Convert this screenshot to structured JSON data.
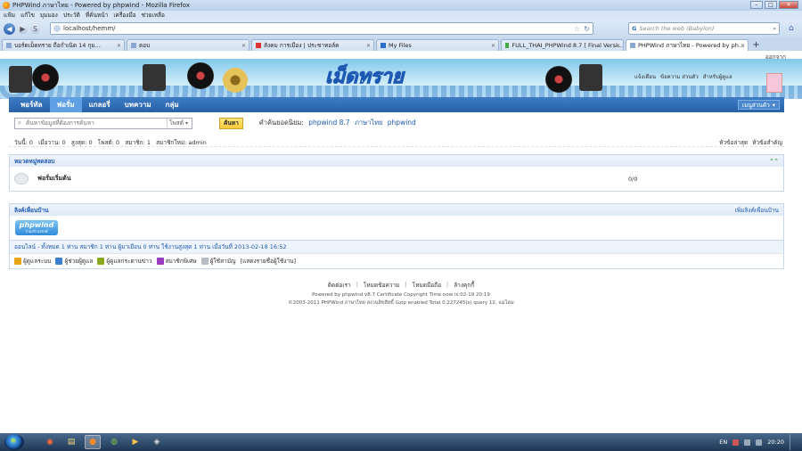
{
  "browser": {
    "window_title": "PHPWind ภาษาไทย - Powered by phpwind - Mozilla Firefox",
    "menu": [
      "แฟ้ม",
      "แก้ไข",
      "มุมมอง",
      "ประวัติ",
      "ที่คั่นหน้า",
      "เครื่องมือ",
      "ช่วยเหลือ"
    ],
    "url": "localhost/hemm/",
    "search_placeholder": "Search the web (Babylon)",
    "search_engine_glyph": "G",
    "tabs": [
      {
        "label": "บอร์ดเม็ดทราย ถือกำเนิด 14 กุม...",
        "active": false
      },
      {
        "label": "ตอบ",
        "active": false
      },
      {
        "label": "สังคม การเมือง | ประชาทอล์ค",
        "active": false
      },
      {
        "label": "My Files",
        "active": false
      },
      {
        "label": "FULL_THAI_PHPWind 8.7 [ Final Versi...",
        "active": false
      },
      {
        "label": "PHPWind ภาษาไทย - Powered by ph...",
        "active": true
      }
    ]
  },
  "site": {
    "top_right_link": "ออกจาก",
    "logo_text": "เม็ดทราย",
    "user_links": [
      "แจ้งเตือน",
      "ข้อความ ส่วนตัว",
      "สำหรับผู้ดูแล"
    ],
    "nav": [
      {
        "label": "พอร์ทัล",
        "active": false
      },
      {
        "label": "ฟอรั่ม",
        "active": true
      },
      {
        "label": "แกลอรี่",
        "active": false
      },
      {
        "label": "บทความ",
        "active": false
      },
      {
        "label": "กลุ่ม",
        "active": false
      }
    ],
    "user_menu": "เมนูส่วนตัว",
    "search": {
      "placeholder": "ค้นหาข้อมูลที่ต้องการค้นหา",
      "type": "โพสต์",
      "button": "ค้นหา",
      "hot_label": "คำค้นยอดนิยม:",
      "hot_words": [
        "phpwind 8.7",
        "ภาษาไทย",
        "phpwind"
      ]
    },
    "stats": {
      "left": "วันนี้: 0   เมื่อวาน: 0   สูงสุด: 0   โพสต์: 0   สมาชิก: 1   สมาชิกใหม่: admin",
      "right": [
        "หัวข้อล่าสุด",
        "หัวข้อสำคัญ"
      ]
    },
    "category": {
      "title": "หมวดหมู่ทดสอบ",
      "toggle_glyph": "⌃⌃",
      "forums": [
        {
          "name": "ฟอรั่มเริ่มต้น",
          "count": "0/0"
        }
      ]
    },
    "friend_links": {
      "title": "ลิงค์เพื่อนบ้าน",
      "add": "เพิ่มลิงค์เพื่อนบ้าน",
      "logo_text": "phpwind",
      "logo_sub": "ร่วมสร้างสรรค์"
    },
    "online": "ออนไลน์ - ทั้งหมด 1 ท่าน สมาชิก 1 ท่าน ผู้มาเยือน 0 ท่าน ใช้งานสูงสุด 1 ท่าน เมื่อวันที่ 2013-02-18 16:52",
    "legend": [
      {
        "label": "ผู้ดูแลระบบ",
        "color": "#e8a417"
      },
      {
        "label": "ผู้ช่วยผู้ดูแล",
        "color": "#3c7fd1"
      },
      {
        "label": "ผู้ดูแลกระดานข่าว",
        "color": "#8aa81e"
      },
      {
        "label": "สมาชิกพิเศษ",
        "color": "#9a3cc0"
      },
      {
        "label": "ผู้ใช้สามัญ",
        "color": "#b6bcc6"
      },
      {
        "label": "[แสดงรายชื่อผู้ใช้งาน]",
        "color": ""
      }
    ],
    "footer": {
      "links": [
        "ติดต่อเรา",
        "โหมดข้อความ",
        "โหมดมือถือ",
        "ล้างคุกกี้"
      ],
      "line1": "Powered by phpwind v8.7 Certificate Copyright Time now is:02-19 20:19",
      "line2": "©2003-2011 PHPWind ภาษาไทย สงวนลิขสิทธิ์ Gzip enabled Total 0.227245(s) query 12, แม่โดม"
    }
  },
  "taskbar": {
    "lang": "EN",
    "clock": "20:20"
  }
}
